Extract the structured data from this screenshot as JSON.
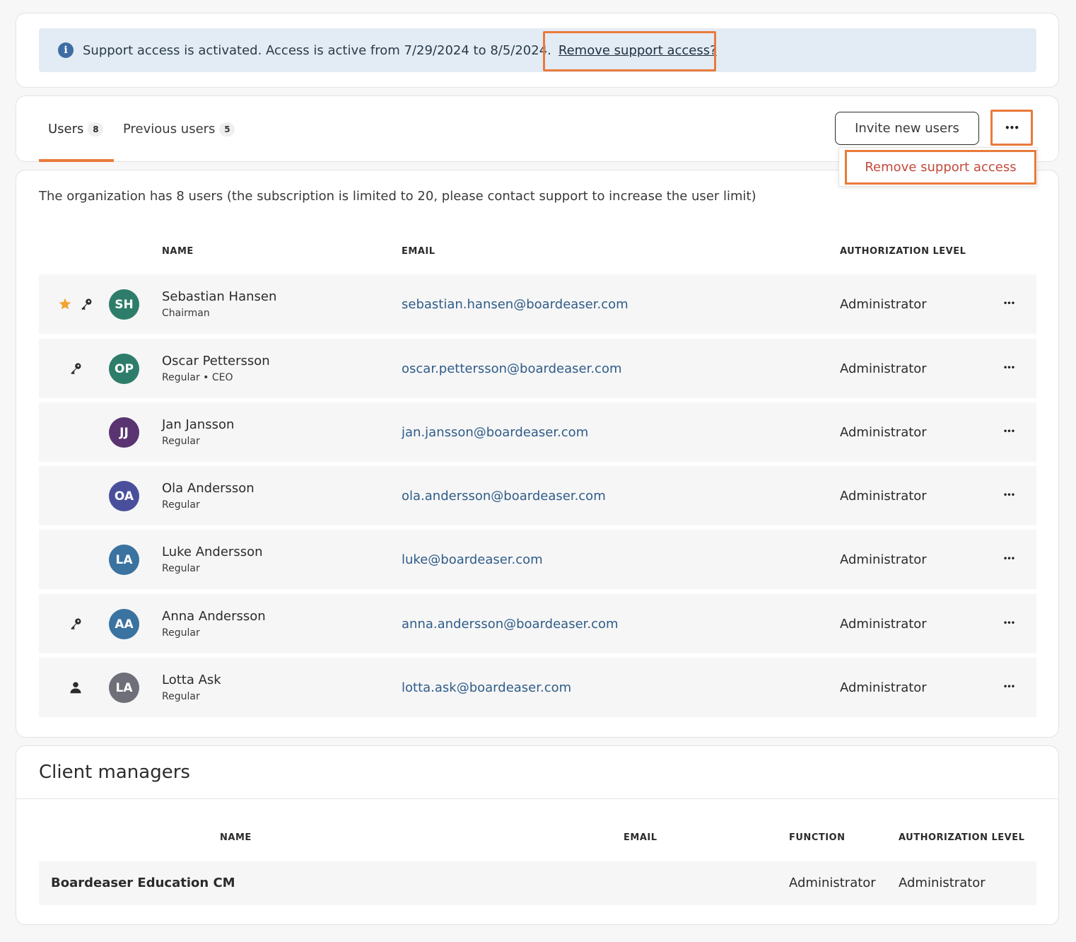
{
  "banner": {
    "message": "Support access is activated. Access is active from 7/29/2024 to 8/5/2024.",
    "link_text": "Remove support access?"
  },
  "tabs": [
    {
      "label": "Users",
      "count": "8",
      "active": true
    },
    {
      "label": "Previous users",
      "count": "5",
      "active": false
    }
  ],
  "actions": {
    "invite_label": "Invite new users",
    "more_label": "•••",
    "dropdown_item": "Remove support access"
  },
  "users_section": {
    "summary": "The organization has 8 users (the subscription is limited to 20, please contact support to increase the user limit)",
    "columns": {
      "name": "NAME",
      "email": "EMAIL",
      "level": "AUTHORIZATION LEVEL"
    },
    "rows": [
      {
        "initials": "SH",
        "name": "Sebastian Hansen",
        "role": "Chairman",
        "email": "sebastian.hansen@boardeaser.com",
        "level": "Administrator",
        "avatar_color": "#2e7d6b",
        "icons": [
          "star-icon",
          "key-icon"
        ]
      },
      {
        "initials": "OP",
        "name": "Oscar Pettersson",
        "role": "Regular • CEO",
        "email": "oscar.pettersson@boardeaser.com",
        "level": "Administrator",
        "avatar_color": "#2e7d6b",
        "icons": [
          "key-icon"
        ]
      },
      {
        "initials": "JJ",
        "name": "Jan Jansson",
        "role": "Regular",
        "email": "jan.jansson@boardeaser.com",
        "level": "Administrator",
        "avatar_color": "#5a3470",
        "icons": []
      },
      {
        "initials": "OA",
        "name": "Ola Andersson",
        "role": "Regular",
        "email": "ola.andersson@boardeaser.com",
        "level": "Administrator",
        "avatar_color": "#4a4f9c",
        "icons": []
      },
      {
        "initials": "LA",
        "name": "Luke Andersson",
        "role": "Regular",
        "email": "luke@boardeaser.com",
        "level": "Administrator",
        "avatar_color": "#3a72a0",
        "icons": []
      },
      {
        "initials": "AA",
        "name": "Anna Andersson",
        "role": "Regular",
        "email": "anna.andersson@boardeaser.com",
        "level": "Administrator",
        "avatar_color": "#3a72a0",
        "icons": [
          "key-icon"
        ]
      },
      {
        "initials": "LA",
        "name": "Lotta Ask",
        "role": "Regular",
        "email": "lotta.ask@boardeaser.com",
        "level": "Administrator",
        "avatar_color": "#6f6f7a",
        "icons": [
          "person-icon"
        ]
      }
    ],
    "row_more_label": "•••"
  },
  "client_managers": {
    "title": "Client managers",
    "columns": {
      "name": "NAME",
      "email": "EMAIL",
      "function": "FUNCTION",
      "level": "AUTHORIZATION LEVEL"
    },
    "rows": [
      {
        "name": "Boardeaser Education CM",
        "email": "",
        "function": "Administrator",
        "level": "Administrator"
      }
    ]
  },
  "colors": {
    "accent": "#ea7a3b",
    "link": "#2f5c89",
    "danger": "#c24a3a",
    "banner_bg": "#e3ecf4",
    "star": "#f2a531"
  }
}
